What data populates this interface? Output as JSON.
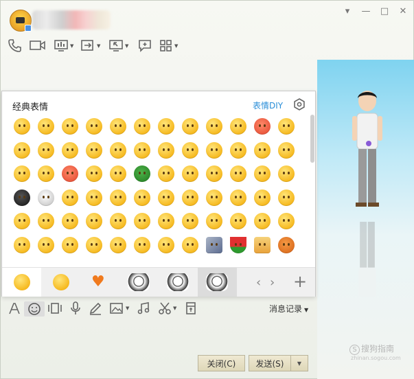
{
  "window": {
    "controls": [
      "▾",
      "—",
      "□",
      "✕"
    ]
  },
  "toolbar": {
    "icons": [
      "phone-icon",
      "video-icon",
      "screen-share-icon",
      "transfer-file-icon",
      "remote-desktop-icon",
      "message-box-icon",
      "apps-icon"
    ]
  },
  "emoji_panel": {
    "title": "经典表情",
    "diy_label": "表情DIY",
    "tabs": [
      "classic-face",
      "yellow-face",
      "heart",
      "sticker-black-white",
      "sticker-face",
      "sticker-round"
    ],
    "navigation": {
      "prev": "‹",
      "next": "›",
      "add": "+"
    }
  },
  "input_toolbar": {
    "history_label": "消息记录"
  },
  "buttons": {
    "close_label": "关闭(C)",
    "send_label": "发送(S)"
  },
  "watermark": {
    "line1": "搜狗指南",
    "line2": "zhinan.sogou.com"
  },
  "colors": {
    "accent_link": "#2a8ed8",
    "button_bg": "#e8e2c6"
  }
}
